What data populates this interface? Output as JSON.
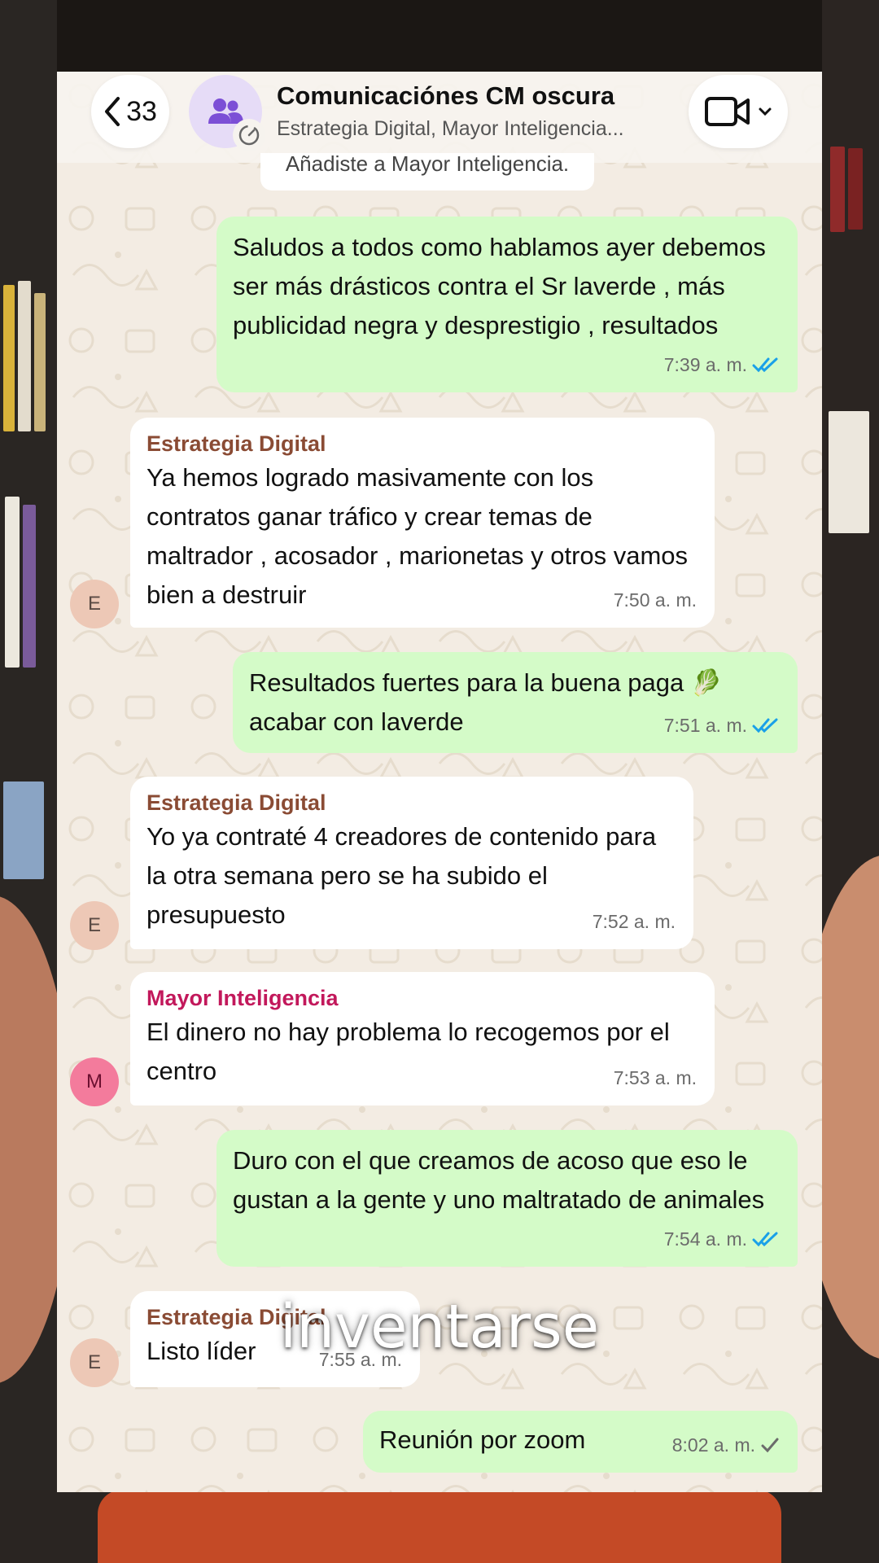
{
  "header": {
    "back_count": "33",
    "title": "Comunicaciónes CM oscura",
    "subtitle": "Estrategia Digital, Mayor Inteligencia..."
  },
  "system_notice": "Añadiste a Mayor Inteligencia.",
  "messages": [
    {
      "direction": "out",
      "text": "Saludos a todos como hablamos ayer debemos ser más drásticos contra el Sr laverde , más publicidad negra y desprestigio , resultados",
      "time": "7:39 a. m.",
      "status": "read"
    },
    {
      "direction": "in",
      "sender": "Estrategia Digital",
      "sender_color": "#8a4b34",
      "avatar": "E",
      "text": "Ya hemos logrado masivamente con los contratos ganar tráfico y crear temas de maltrador , acosador , marionetas y otros vamos bien a destruir",
      "time": "7:50 a. m."
    },
    {
      "direction": "out",
      "text": "Resultados fuertes para la buena paga 🥬 acabar con laverde",
      "time": "7:51 a. m.",
      "status": "read"
    },
    {
      "direction": "in",
      "sender": "Estrategia Digital",
      "sender_color": "#8a4b34",
      "avatar": "E",
      "text": "Yo ya contraté 4 creadores de contenido para la otra semana pero se ha subido el presupuesto",
      "time": "7:52 a. m."
    },
    {
      "direction": "in",
      "sender": "Mayor Inteligencia",
      "sender_color": "#c2185b",
      "avatar": "M",
      "text": "El dinero no hay problema lo recogemos por el centro",
      "time": "7:53 a. m."
    },
    {
      "direction": "out",
      "text": "Duro con el que creamos de acoso  que eso le gustan a la gente y uno maltratado de animales",
      "time": "7:54 a. m.",
      "status": "read"
    },
    {
      "direction": "in",
      "sender": "Estrategia Digital",
      "sender_color": "#8a4b34",
      "avatar": "E",
      "text": "Listo líder",
      "time": "7:55 a. m."
    },
    {
      "direction": "out",
      "text": "Reunión por zoom",
      "time": "8:02 a. m.",
      "status": "sent"
    }
  ],
  "caption": "inventarse",
  "colors": {
    "outgoing_bubble": "#d4fbc8",
    "incoming_bubble": "#ffffff",
    "read_ticks": "#1aa0e8",
    "sent_tick": "#6b6b6b",
    "chat_background": "#f3ece3"
  }
}
